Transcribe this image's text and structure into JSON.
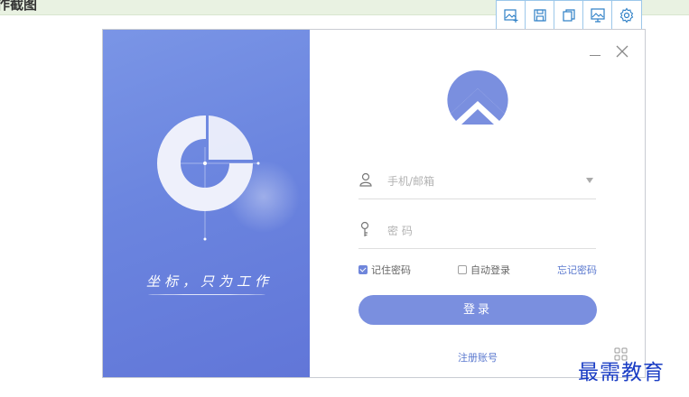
{
  "header": {
    "title": "作截图",
    "toolbar": [
      {
        "icon": "image-add-icon"
      },
      {
        "icon": "save-icon"
      },
      {
        "icon": "copy-icon"
      },
      {
        "icon": "desktop-image-icon"
      },
      {
        "icon": "gear-icon"
      }
    ]
  },
  "left_panel": {
    "slogan": "坐标，只为工作"
  },
  "window_controls": {
    "minimize": "–",
    "close": "×"
  },
  "form": {
    "account_placeholder": "手机/邮箱",
    "password_placeholder": "密 码",
    "remember_label": "记住密码",
    "remember_checked": true,
    "autologin_label": "自动登录",
    "autologin_checked": false,
    "forgot_label": "忘记密码",
    "login_label": "登录",
    "register_label": "注册账号"
  },
  "watermark": "最需教育",
  "colors": {
    "accent": "#7a8fdf",
    "panel": "#6b85df",
    "link": "#5b79cf",
    "watermark": "#1a3dc4"
  }
}
